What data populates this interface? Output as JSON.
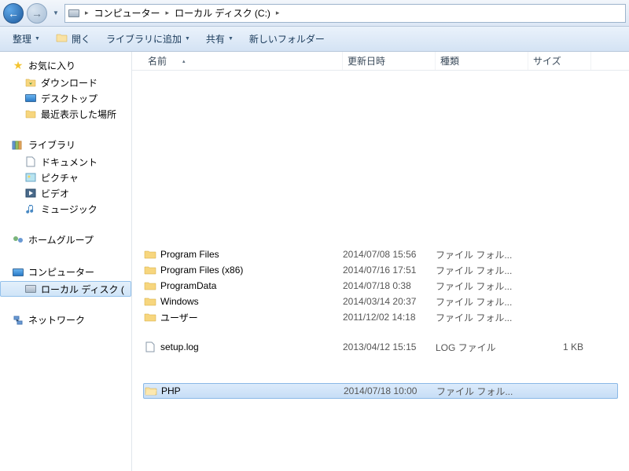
{
  "breadcrumb": {
    "segments": [
      "コンピューター",
      "ローカル ディスク (C:)"
    ]
  },
  "toolbar": {
    "organize": "整理",
    "open": "開く",
    "add_to_library": "ライブラリに追加",
    "share": "共有",
    "new_folder": "新しいフォルダー"
  },
  "sidebar": {
    "favorites": {
      "label": "お気に入り",
      "items": [
        {
          "label": "ダウンロード",
          "icon": "download"
        },
        {
          "label": "デスクトップ",
          "icon": "desktop"
        },
        {
          "label": "最近表示した場所",
          "icon": "recent"
        }
      ]
    },
    "libraries": {
      "label": "ライブラリ",
      "items": [
        {
          "label": "ドキュメント",
          "icon": "doc"
        },
        {
          "label": "ピクチャ",
          "icon": "pic"
        },
        {
          "label": "ビデオ",
          "icon": "video"
        },
        {
          "label": "ミュージック",
          "icon": "music"
        }
      ]
    },
    "homegroup": {
      "label": "ホームグループ"
    },
    "computer": {
      "label": "コンピューター",
      "items": [
        {
          "label": "ローカル ディスク (",
          "icon": "drive",
          "selected": true
        }
      ]
    },
    "network": {
      "label": "ネットワーク"
    }
  },
  "columns": {
    "name": "名前",
    "date": "更新日時",
    "type": "種類",
    "size": "サイズ"
  },
  "files": {
    "group1": [
      {
        "name": "Program Files",
        "date": "2014/07/08 15:56",
        "type": "ファイル フォル...",
        "icon": "folder"
      },
      {
        "name": "Program Files (x86)",
        "date": "2014/07/16 17:51",
        "type": "ファイル フォル...",
        "icon": "folder"
      },
      {
        "name": "ProgramData",
        "date": "2014/07/18 0:38",
        "type": "ファイル フォル...",
        "icon": "folder"
      },
      {
        "name": "Windows",
        "date": "2014/03/14 20:37",
        "type": "ファイル フォル...",
        "icon": "folder"
      },
      {
        "name": "ユーザー",
        "date": "2011/12/02 14:18",
        "type": "ファイル フォル...",
        "icon": "folder"
      }
    ],
    "group2": [
      {
        "name": "setup.log",
        "date": "2013/04/12 15:15",
        "type": "LOG ファイル",
        "size": "1 KB",
        "icon": "file"
      }
    ],
    "group3": [
      {
        "name": "PHP",
        "date": "2014/07/18 10:00",
        "type": "ファイル フォル...",
        "icon": "folder-open",
        "selected": true
      }
    ]
  }
}
